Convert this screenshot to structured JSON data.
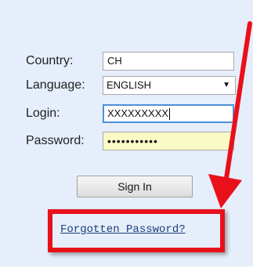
{
  "form": {
    "country_label": "Country:",
    "country_value": "CH",
    "language_label": "Language:",
    "language_value": "ENGLISH",
    "login_label": "Login:",
    "login_value": "XXXXXXXXX",
    "password_label": "Password:",
    "password_mask": "•••••••••••"
  },
  "actions": {
    "sign_in_label": "Sign In",
    "forgot_password_label": "Forgotten Password?"
  },
  "annotation": {
    "color": "#e8111b"
  },
  "colors": {
    "panel_background": "#e5eefa",
    "link": "#1a3f7a",
    "password_autofill": "#fafac7",
    "focus_border": "#4d90d8"
  }
}
